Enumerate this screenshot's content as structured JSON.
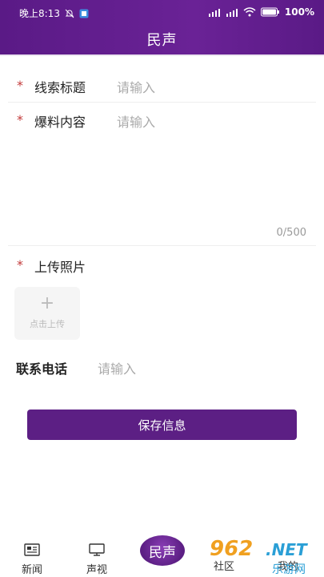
{
  "status_bar": {
    "time": "晚上8:13",
    "battery": "100%"
  },
  "header": {
    "title": "民声"
  },
  "form": {
    "clue_title": {
      "label": "线索标题",
      "placeholder": "请输入"
    },
    "content": {
      "label": "爆料内容",
      "placeholder": "请输入",
      "counter": "0/500"
    },
    "upload": {
      "label": "上传照片",
      "button_text": "点击上传",
      "plus": "+"
    },
    "phone": {
      "label": "联系电话",
      "placeholder": "请输入"
    },
    "required_mark": "*"
  },
  "save_button": {
    "label": "保存信息"
  },
  "tabbar": {
    "items": [
      {
        "label": "新闻",
        "icon": "news-icon"
      },
      {
        "label": "声视",
        "icon": "tv-icon"
      },
      {
        "label": "民声",
        "icon": "center-logo"
      },
      {
        "label": "社区",
        "icon": "community-icon"
      },
      {
        "label": "我的",
        "icon": "profile-icon"
      }
    ]
  },
  "watermark": {
    "number": "962",
    "net": ".NET",
    "text": "乐游网"
  },
  "colors": {
    "brand_purple": "#5c1f84",
    "required_red": "#c23a3a"
  }
}
